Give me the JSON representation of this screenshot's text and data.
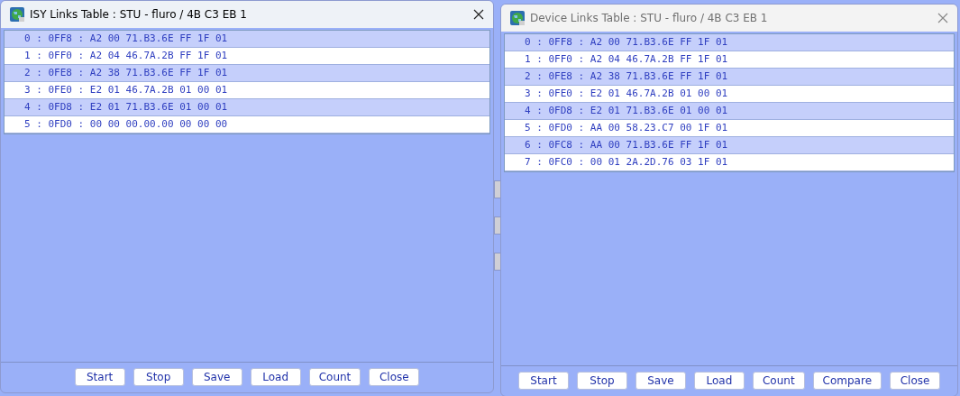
{
  "windows": [
    {
      "title": "ISY Links Table : STU - fluro / 4B C3 EB 1",
      "active": true,
      "rows": [
        "0 : 0FF8 : A2 00 71.B3.6E FF 1F 01",
        "1 : 0FF0 : A2 04 46.7A.2B FF 1F 01",
        "2 : 0FE8 : A2 38 71.B3.6E FF 1F 01",
        "3 : 0FE0 : E2 01 46.7A.2B 01 00 01",
        "4 : 0FD8 : E2 01 71.B3.6E 01 00 01",
        "5 : 0FD0 : 00 00 00.00.00 00 00 00"
      ],
      "buttons": [
        "Start",
        "Stop",
        "Save",
        "Load",
        "Count",
        "Close"
      ]
    },
    {
      "title": "Device Links Table : STU - fluro / 4B C3 EB 1",
      "active": false,
      "rows": [
        "0 : 0FF8 : A2 00 71.B3.6E FF 1F 01",
        "1 : 0FF0 : A2 04 46.7A.2B FF 1F 01",
        "2 : 0FE8 : A2 38 71.B3.6E FF 1F 01",
        "3 : 0FE0 : E2 01 46.7A.2B 01 00 01",
        "4 : 0FD8 : E2 01 71.B3.6E 01 00 01",
        "5 : 0FD0 : AA 00 58.23.C7 00 1F 01",
        "6 : 0FC8 : AA 00 71.B3.6E FF 1F 01",
        "7 : 0FC0 : 00 01 2A.2D.76 03 1F 01"
      ],
      "buttons": [
        "Start",
        "Stop",
        "Save",
        "Load",
        "Count",
        "Compare",
        "Close"
      ]
    }
  ]
}
